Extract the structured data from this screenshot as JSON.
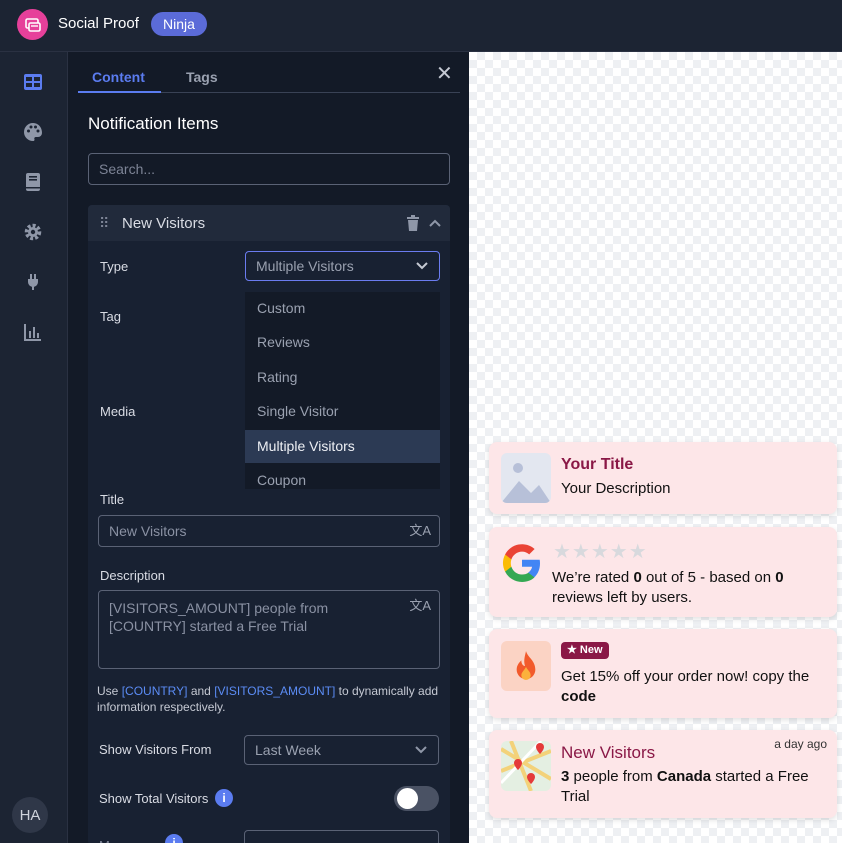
{
  "header": {
    "app_title": "Social Proof",
    "plan_badge": "Ninja"
  },
  "rail": {
    "items": [
      "dashboard-icon",
      "palette-icon",
      "book-icon",
      "gear-icon",
      "plug-icon",
      "chart-icon"
    ],
    "avatar": "HA"
  },
  "panel": {
    "tabs": [
      "Content",
      "Tags"
    ],
    "section_title": "Notification Items",
    "search_placeholder": "Search...",
    "item": {
      "title": "New Visitors",
      "type_label": "Type",
      "type_value": "Multiple Visitors",
      "tag_label": "Tag",
      "media_label": "Media",
      "dropdown_options": [
        "Custom",
        "Reviews",
        "Rating",
        "Single Visitor",
        "Multiple Visitors",
        "Coupon"
      ],
      "selected_option": "Multiple Visitors",
      "title_label": "Title",
      "title_value": "New Visitors",
      "description_label": "Description",
      "description_value": "[VISITORS_AMOUNT] people from [COUNTRY] started a Free Trial",
      "help": {
        "pre": "Use ",
        "var1": "[COUNTRY]",
        "mid": " and ",
        "var2": "[VISITORS_AMOUNT]",
        "post": " to dynamically add information respectively."
      },
      "visitors_from_label": "Show Visitors From",
      "visitors_from_value": "Last Week",
      "total_visitors_label": "Show Total Visitors",
      "total_visitors_on": false
    }
  },
  "preview": {
    "card1": {
      "title": "Your Title",
      "description": "Your Description"
    },
    "card2": {
      "rating_prefix": "We’re rated ",
      "rating": "0",
      "rating_mid": " out of 5 - based on ",
      "reviews": "0",
      "rating_suffix": " reviews left by users.",
      "stars_filled": 0,
      "stars_total": 5
    },
    "card3": {
      "badge": "New",
      "text_pre": "Get 15% off your order now! copy the ",
      "text_bold": "code"
    },
    "card4": {
      "title": "New Visitors",
      "time": "a day ago",
      "count": "3",
      "mid": " people from ",
      "country": "Canada",
      "suffix": " started a Free Trial"
    }
  },
  "colors": {
    "accent": "#5b7cf0",
    "brand_pink": "#e6409a",
    "badge": "#5b6bd8",
    "notif_bg": "#fde6e8",
    "notif_title": "#8a1846"
  }
}
